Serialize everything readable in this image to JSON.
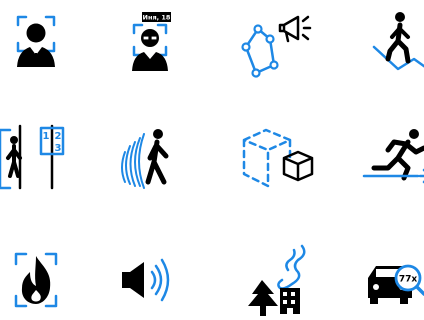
{
  "colors": {
    "accent": "#1e88e5",
    "ink": "#000000",
    "background": "#ffffff"
  },
  "icons": [
    {
      "name": "face-recognition-icon"
    },
    {
      "name": "face-id-name-icon",
      "badge_text": "Иня, 18"
    },
    {
      "name": "map-route-announcement-icon"
    },
    {
      "name": "person-walking-up-stairs-icon"
    },
    {
      "name": "queue-numbering-icon",
      "numbers": [
        "1",
        "2",
        "3"
      ]
    },
    {
      "name": "motion-detection-icon"
    },
    {
      "name": "abandoned-object-detection-icon"
    },
    {
      "name": "running-person-detection-icon"
    },
    {
      "name": "fire-detection-icon"
    },
    {
      "name": "audio-speaker-icon"
    },
    {
      "name": "smoke-detection-icon"
    },
    {
      "name": "vehicle-zoom-icon",
      "zoom_text": "77x"
    }
  ]
}
